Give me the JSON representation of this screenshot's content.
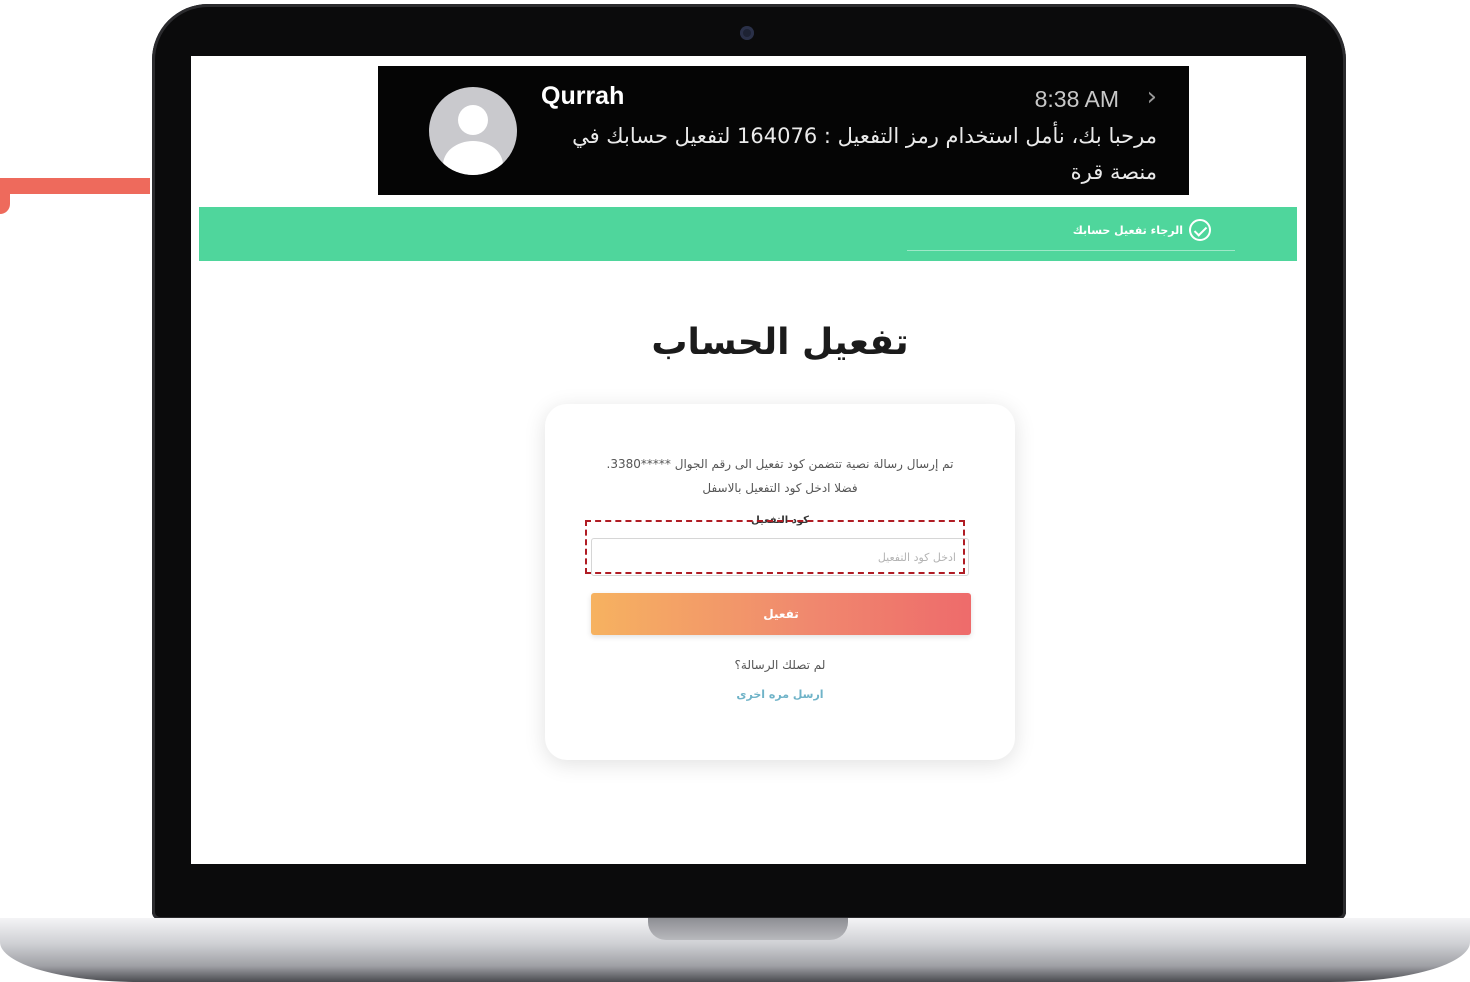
{
  "notification": {
    "sender": "Qurrah",
    "time": "8:38 AM",
    "message": "مرحبا بك، نأمل استخدام رمز التفعيل : 164076 لتفعيل حسابك في منصة قرة"
  },
  "status_bar": {
    "text": "الرجاء تفعيل حسابك"
  },
  "page": {
    "title": "تفعيل الحساب"
  },
  "card": {
    "message_line1": "تم إرسال رسالة نصية تتضمن كود تفعيل الى رقم الجوال *****3380.",
    "message_line2": "فضلا ادخل كود التفعيل بالاسفل",
    "field_label": "كود التفعيل",
    "input_placeholder": "ادخل كود التفعيل",
    "input_value": "",
    "button_label": "تفعيل",
    "no_message_text": "لم تصلك الرسالة؟",
    "resend_label": "ارسل مره اخرى"
  },
  "colors": {
    "green_bar": "#4fd69c",
    "accent_red": "#ee6a5c",
    "button_gradient_start": "#f6b260",
    "button_gradient_end": "#ee6b6b",
    "link": "#6fb3c8",
    "highlight_dashed": "#b01c24"
  },
  "icons": {
    "notification_avatar": "user-avatar-icon",
    "notification_chevron": "chevron-right-icon",
    "status": "check-circle-icon"
  }
}
